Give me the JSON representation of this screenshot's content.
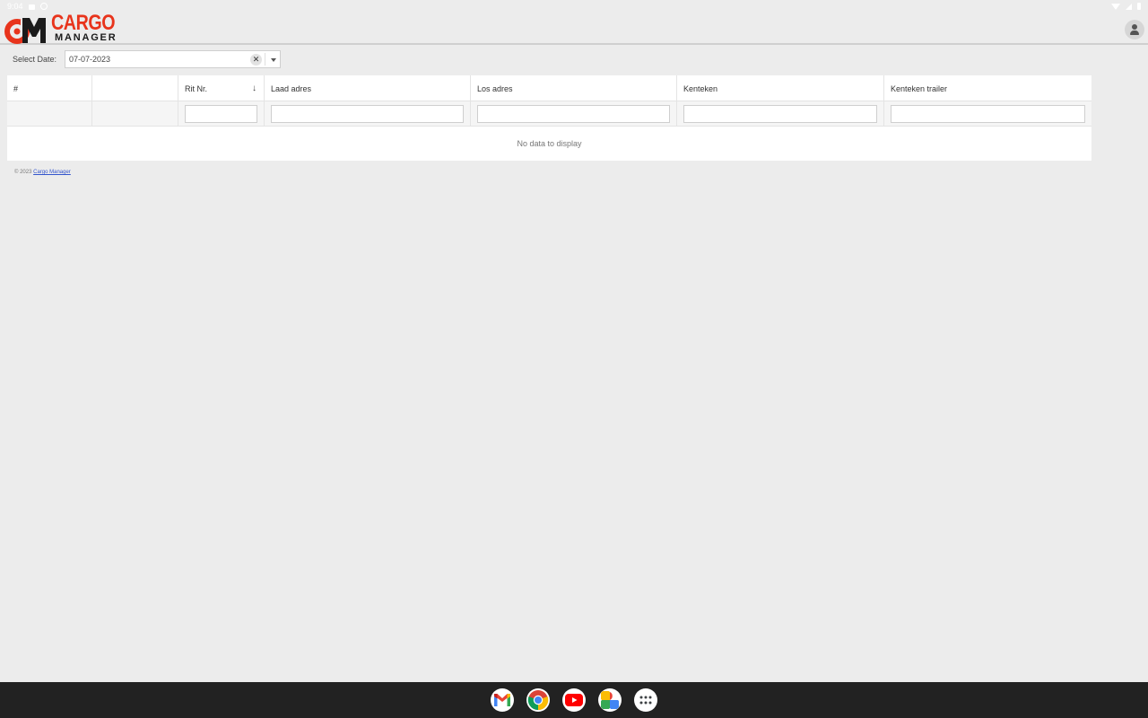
{
  "status_bar": {
    "time": "9:04"
  },
  "brand": {
    "name_top": "CARGO",
    "name_bottom": "MANAGER",
    "accent": "#e8341c",
    "dark": "#1b1b1b"
  },
  "header": {
    "avatar_icon": "account-icon"
  },
  "date_selector": {
    "label": "Select Date:",
    "value": "07-07-2023"
  },
  "grid": {
    "columns": [
      {
        "label": "#",
        "filter": false
      },
      {
        "label": "",
        "filter": false
      },
      {
        "label": "Rit Nr.",
        "filter": true,
        "sorted": "desc"
      },
      {
        "label": "Laad adres",
        "filter": true
      },
      {
        "label": "Los adres",
        "filter": true
      },
      {
        "label": "Kenteken",
        "filter": true
      },
      {
        "label": "Kenteken trailer",
        "filter": true
      }
    ],
    "empty_text": "No data to display"
  },
  "footer": {
    "copyright": "© 2023 ",
    "link_text": "Cargo Manager"
  },
  "dock": {
    "apps": [
      "gmail-icon",
      "chrome-icon",
      "youtube-icon",
      "photos-icon",
      "app-drawer-icon"
    ]
  }
}
